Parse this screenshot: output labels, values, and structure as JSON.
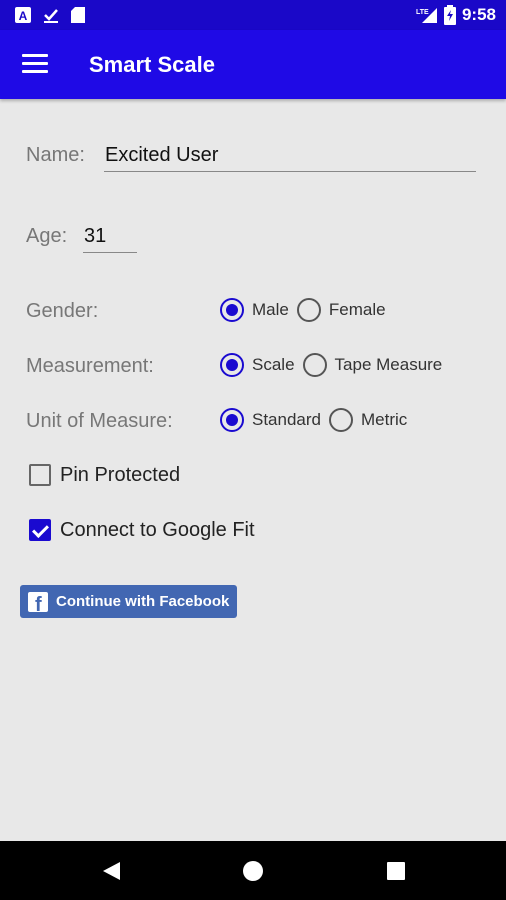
{
  "status_bar": {
    "time": "9:58",
    "network": "LTE",
    "icons": [
      "app-a-icon",
      "download-done-icon",
      "sd-card-icon",
      "signal-icon",
      "battery-charging-icon"
    ]
  },
  "toolbar": {
    "title": "Smart Scale",
    "menu_icon": "hamburger-menu-icon"
  },
  "form": {
    "name_label": "Name:",
    "name_value": "Excited User",
    "age_label": "Age:",
    "age_value": "31",
    "gender_label": "Gender:",
    "gender_options": [
      "Male",
      "Female"
    ],
    "gender_selected": "Male",
    "measurement_label": "Measurement:",
    "measurement_options": [
      "Scale",
      "Tape Measure"
    ],
    "measurement_selected": "Scale",
    "unit_label": "Unit of Measure:",
    "unit_options": [
      "Standard",
      "Metric"
    ],
    "unit_selected": "Standard",
    "pin_label": "Pin Protected",
    "pin_checked": false,
    "google_fit_label": "Connect to Google Fit",
    "google_fit_checked": true
  },
  "facebook": {
    "label": "Continue with Facebook",
    "icon": "facebook-icon"
  },
  "nav": {
    "back_icon": "back-triangle-icon",
    "home_icon": "home-circle-icon",
    "recents_icon": "recents-square-icon"
  },
  "colors": {
    "toolbar": "#1f0ae6",
    "status_bar": "#1a08c8",
    "accent": "#1a0ad0",
    "facebook": "#4267b2",
    "background": "#e8e8e8"
  }
}
